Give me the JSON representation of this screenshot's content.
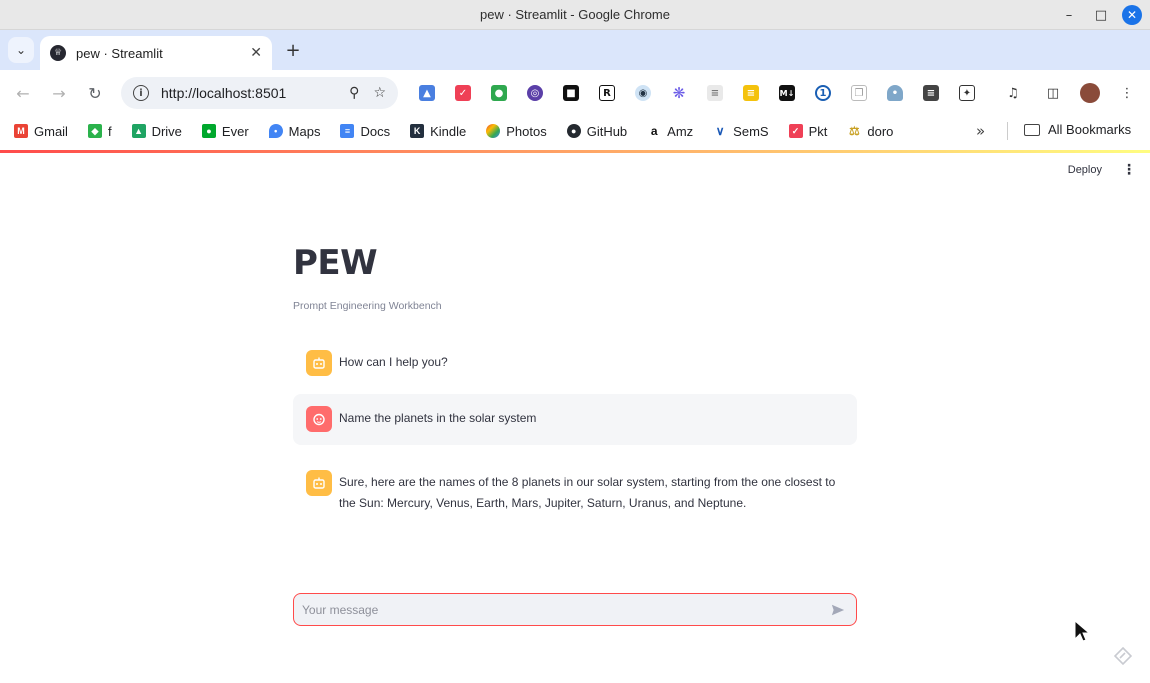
{
  "window": {
    "title": "pew · Streamlit - Google Chrome"
  },
  "tab": {
    "title": "pew · Streamlit",
    "favicon": "streamlit-crown-icon"
  },
  "omnibox": {
    "url": "http://localhost:8501"
  },
  "extensions": [
    "pin-icon",
    "pocket-icon",
    "evernote-icon",
    "privacy-icon",
    "lock-icon",
    "R",
    "eye-icon",
    "asterisk-icon",
    "doc-icon",
    "keep-icon",
    "M↓",
    "1password-icon",
    "copy-icon",
    "ghost-icon",
    "notes-icon",
    "puzzle-icon"
  ],
  "bookmarks": [
    {
      "label": "Gmail",
      "icon": "gmail-icon",
      "color": "#ea4335"
    },
    {
      "label": "f",
      "icon": "feedly-icon",
      "color": "#2bb24c"
    },
    {
      "label": "Drive",
      "icon": "drive-icon",
      "color": "#1fa463"
    },
    {
      "label": "Ever",
      "icon": "evernote-icon",
      "color": "#00a82d"
    },
    {
      "label": "Maps",
      "icon": "maps-icon",
      "color": "#4285f4"
    },
    {
      "label": "Docs",
      "icon": "docs-icon",
      "color": "#4285f4"
    },
    {
      "label": "Kindle",
      "icon": "kindle-icon",
      "color": "#232f3e"
    },
    {
      "label": "Photos",
      "icon": "photos-icon",
      "color": "#fbbc04"
    },
    {
      "label": "GitHub",
      "icon": "github-icon",
      "color": "#24292f"
    },
    {
      "label": "Amz",
      "icon": "amazon-icon",
      "color": "#232f3e"
    },
    {
      "label": "SemS",
      "icon": "semantic-scholar-icon",
      "color": "#1857b6"
    },
    {
      "label": "Pkt",
      "icon": "pocket-icon",
      "color": "#ef4056"
    },
    {
      "label": "doro",
      "icon": "doro-icon",
      "color": "#c9a227"
    }
  ],
  "all_bookmarks": "All Bookmarks",
  "st_header": {
    "deploy": "Deploy"
  },
  "app": {
    "title": "PEW",
    "caption": "Prompt Engineering Workbench"
  },
  "messages": [
    {
      "role": "assistant",
      "text": "How can I help you?"
    },
    {
      "role": "user",
      "text": "Name the planets in the solar system"
    },
    {
      "role": "assistant",
      "text": "Sure, here are the names of the 8 planets in our solar system, starting from the one closest to the Sun: Mercury, Venus, Earth, Mars, Jupiter, Saturn, Uranus, and Neptune."
    }
  ],
  "chat_input": {
    "placeholder": "Your message",
    "value": ""
  },
  "colors": {
    "accent": "#ff4b4b",
    "bot_avatar": "#ffbd45",
    "user_avatar": "#ff6c6c",
    "text": "#31333f"
  }
}
